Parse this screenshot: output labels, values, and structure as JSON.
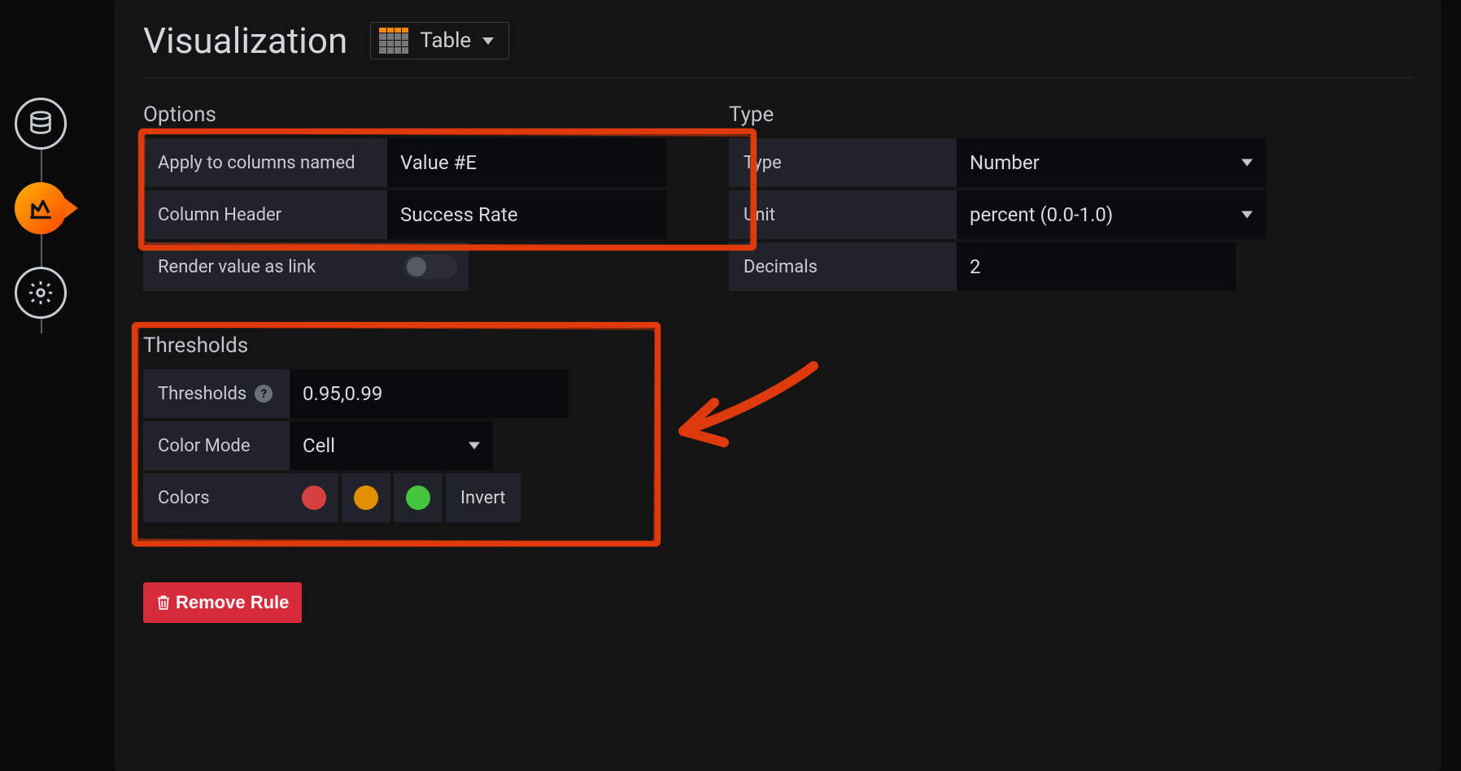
{
  "header": {
    "title": "Visualization",
    "viz_label": "Table"
  },
  "rail": {
    "items": [
      "datasource",
      "visualization",
      "settings"
    ],
    "active": "visualization"
  },
  "options": {
    "section_label": "Options",
    "apply_label": "Apply to columns named",
    "apply_value": "Value #E",
    "header_label": "Column Header",
    "header_value": "Success Rate",
    "link_label": "Render value as link",
    "link_value": false
  },
  "type": {
    "section_label": "Type",
    "type_label": "Type",
    "type_value": "Number",
    "unit_label": "Unit",
    "unit_value": "percent (0.0-1.0)",
    "decimals_label": "Decimals",
    "decimals_value": "2"
  },
  "thresholds": {
    "section_label": "Thresholds",
    "thresholds_label": "Thresholds",
    "thresholds_value": "0.95,0.99",
    "colormode_label": "Color Mode",
    "colormode_value": "Cell",
    "colors_label": "Colors",
    "colors": [
      "#d64040",
      "#e28f00",
      "#45c43d"
    ],
    "invert_label": "Invert"
  },
  "actions": {
    "remove_label": "Remove Rule"
  }
}
